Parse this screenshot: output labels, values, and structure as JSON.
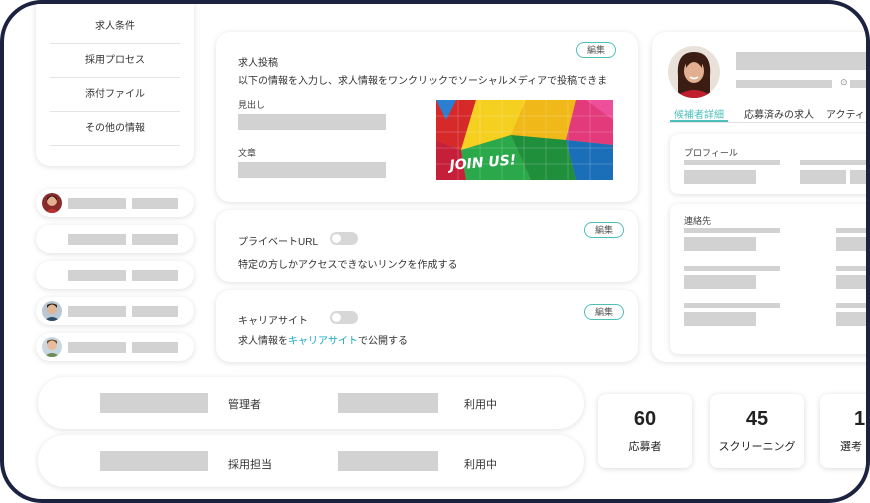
{
  "sidebar_menu": {
    "items": [
      "求人条件",
      "採用プロセス",
      "添付ファイル",
      "その他の情報"
    ]
  },
  "job_post": {
    "title": "求人投稿",
    "description": "以下の情報を入力し、求人情報をワンクリックでソーシャルメディアで投稿できま",
    "headline_label": "見出し",
    "body_label": "文章",
    "edit_label": "編集",
    "banner_text": "JOIN US!"
  },
  "private_url": {
    "label": "プライベートURL",
    "description": "特定の方しかアクセスできないリンクを作成する",
    "edit_label": "編集",
    "enabled": false
  },
  "career_site": {
    "label": "キャリアサイト",
    "description_prefix": "求人情報を",
    "link_text": "キャリアサイト",
    "description_suffix": "で公開する",
    "edit_label": "編集",
    "enabled": false
  },
  "candidate": {
    "tabs": [
      "候補者詳細",
      "応募済みの求人",
      "アクティ"
    ],
    "active_tab": 0,
    "profile_label": "プロフィール",
    "contact_label": "連絡先"
  },
  "team_members": [
    {
      "role": "管理者",
      "status": "利用中"
    },
    {
      "role": "採用担当",
      "status": "利用中"
    }
  ],
  "stats": [
    {
      "value": "60",
      "label": "応募者"
    },
    {
      "value": "45",
      "label": "スクリーニング"
    },
    {
      "value": "1",
      "label": "選考"
    }
  ],
  "colors": {
    "frame": "#1c2340",
    "accent": "#4dbfb9",
    "link": "#1aa7c7",
    "placeholder": "#d2d2d2"
  }
}
